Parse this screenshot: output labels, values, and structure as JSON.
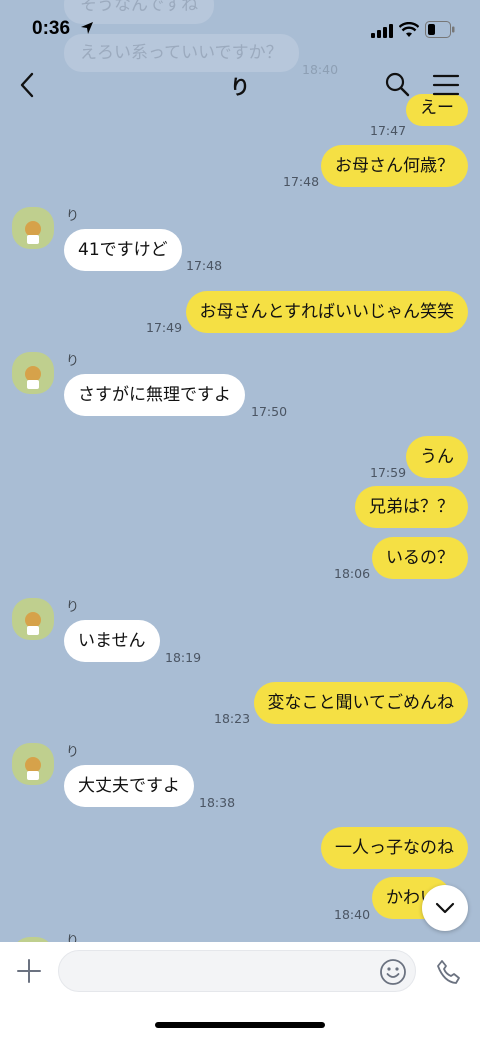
{
  "status": {
    "time": "0:36"
  },
  "ghost": {
    "line1": "そうなんですね",
    "line2": "えろい系っていいですか？",
    "line2_time": "18:40"
  },
  "header": {
    "title": "り"
  },
  "colors": {
    "background": "#a9bdd4",
    "my_bubble": "#f5e044",
    "their_bubble": "#ffffff"
  },
  "messages": [
    {
      "text": "えー",
      "time": "17:47"
    },
    {
      "text": "お母さん何歳？",
      "time": "17:48"
    },
    {
      "sender": "り",
      "text": "41ですけど",
      "time": "17:48"
    },
    {
      "text": "お母さんとすればいいじゃん笑笑",
      "time": "17:49"
    },
    {
      "sender": "り",
      "text": "さすがに無理ですよ",
      "time": "17:50"
    },
    {
      "text": "うん",
      "time": "17:59"
    },
    {
      "text": "兄弟は？？"
    },
    {
      "text": "いるの？",
      "time": "18:06"
    },
    {
      "sender": "り",
      "text": "いません",
      "time": "18:19"
    },
    {
      "text": "変なこと聞いてごめんね",
      "time": "18:23"
    },
    {
      "sender": "り",
      "text": "大丈夫ですよ",
      "time": "18:38"
    },
    {
      "text": "一人っ子なのね"
    },
    {
      "text": "かわい",
      "time": "18:40"
    },
    {
      "sender": "り"
    }
  ],
  "icons": {
    "back": "chevron-left-icon",
    "search": "search-icon",
    "menu": "hamburger-menu-icon",
    "plus": "plus-icon",
    "emoji": "emoji-icon",
    "phone": "phone-icon",
    "scroll": "chevron-down-icon"
  }
}
